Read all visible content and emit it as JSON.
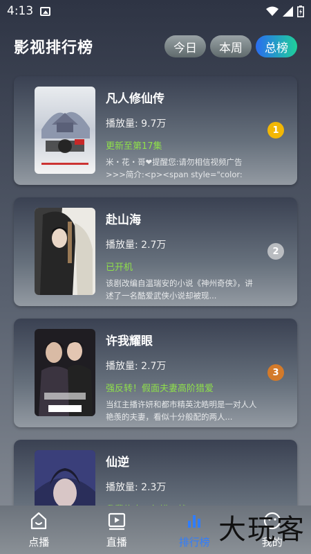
{
  "status": {
    "time": "4:13"
  },
  "header": {
    "title": "影视排行榜",
    "tabs": [
      {
        "label": "今日",
        "active": false
      },
      {
        "label": "本周",
        "active": false
      },
      {
        "label": "总榜",
        "active": true
      }
    ]
  },
  "items": [
    {
      "title": "凡人修仙传",
      "plays": "播放量: 9.7万",
      "update": "更新至第17集",
      "desc": "米・花・哥❤提醒您:请勿相信视频广告>>>简介:<p><span style=\"color: rg...",
      "rank": "1",
      "rank_color": "#f2b705"
    },
    {
      "title": "赴山海",
      "plays": "播放量: 2.7万",
      "update": "已开机",
      "desc": "该剧改编自温瑞安的小说《神州奇侠》，讲述了一名酷爱武侠小说却被现...",
      "rank": "2",
      "rank_color": "#b9bcc0"
    },
    {
      "title": "许我耀眼",
      "plays": "播放量: 2.7万",
      "update": "强反转！假面夫妻高阶猎爱",
      "desc": "当红主播许妍和都市精英沈皓明是一对人人艳羡的夫妻，看似十分般配的两人...",
      "rank": "3",
      "rank_color": "#d37a2a"
    },
    {
      "title": "仙逆",
      "plays": "播放量: 2.3万",
      "update": "我辈修士，何惜一战",
      "desc": "",
      "rank": "",
      "rank_color": ""
    }
  ],
  "nav": [
    {
      "label": "点播",
      "icon": "home-icon",
      "active": false
    },
    {
      "label": "直播",
      "icon": "play-screen-icon",
      "active": false
    },
    {
      "label": "排行榜",
      "icon": "bar-chart-icon",
      "active": true
    },
    {
      "label": "我的",
      "icon": "user-icon",
      "active": false
    }
  ],
  "watermark": "大玩客",
  "colors": {
    "accent": "#2f7dff",
    "update_green": "#8fe04a"
  }
}
